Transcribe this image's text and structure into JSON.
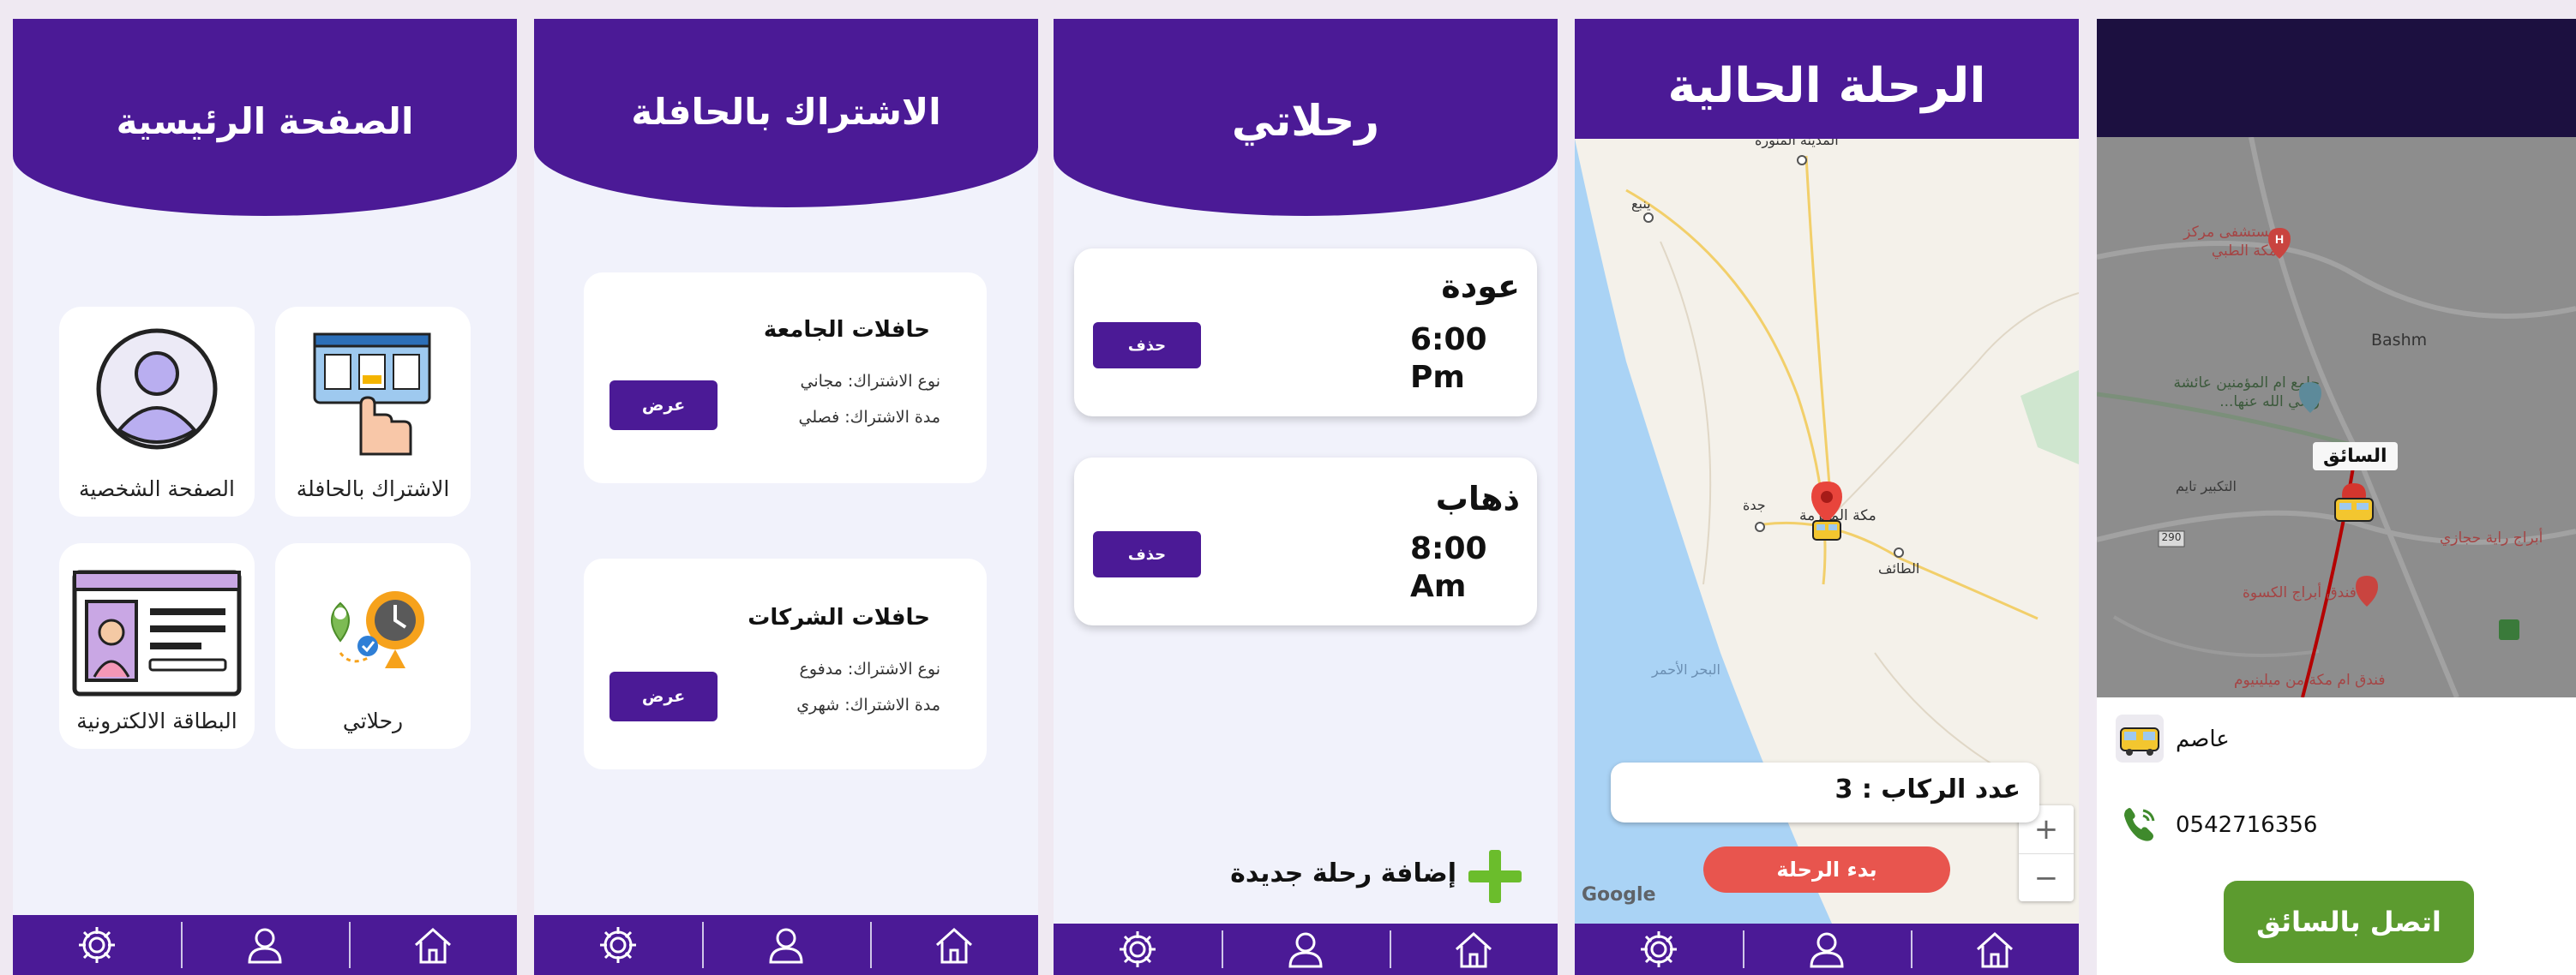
{
  "colors": {
    "primary": "#4b1a96",
    "green": "#5c9b2f",
    "red": "#e8554e",
    "background": "#f1f2fb"
  },
  "nav": {
    "icons": [
      "settings-icon",
      "user-icon",
      "home-icon"
    ]
  },
  "home": {
    "title": "الصفحة الرئيسية",
    "tiles": [
      {
        "label": "الاشتراك بالحافلة",
        "icon": "bus-subscription-icon"
      },
      {
        "label": "الصفحة الشخصية",
        "icon": "profile-icon"
      },
      {
        "label": "رحلاتي",
        "icon": "trips-icon"
      },
      {
        "label": "البطاقة الالكترونية",
        "icon": "id-card-icon"
      }
    ]
  },
  "subscription": {
    "title": "الاشتراك بالحافلة",
    "cards": [
      {
        "title": "حافلات الجامعة",
        "type": "نوع الاشتراك: مجاني",
        "duration": "مدة الاشتراك: فصلي",
        "button": "عرض"
      },
      {
        "title": "حافلات الشركات",
        "type": "نوع الاشتراك: مدفوع",
        "duration": "مدة الاشتراك: شهري",
        "button": "عرض"
      }
    ]
  },
  "trips": {
    "title": "رحلاتي",
    "items": [
      {
        "name": "عودة",
        "time": "6:00",
        "period": "Pm",
        "button": "حذف"
      },
      {
        "name": "ذهاب",
        "time": "8:00",
        "period": "Am",
        "button": "حذف"
      }
    ],
    "add_label": "إضافة رحلة جديدة"
  },
  "current_trip": {
    "title": "الرحلة الحالية",
    "map_labels": {
      "madinah": "المدينة المنورة",
      "yanbu": "ينبع",
      "jeddah": "جدة",
      "makkah": "مكة المكرمة",
      "taif": "الطائف",
      "red_sea": "البحر الأحمر",
      "google": "Google"
    },
    "passengers": "عدد الركاب : 3",
    "start_button": "بدء الرحلة",
    "zoom_in": "+",
    "zoom_out": "−"
  },
  "driver": {
    "map_labels": {
      "hospital": "مستشفى مركز مكة الطبي",
      "mosque": "جامع ام المؤمنين عائشة رضي الله عنها...",
      "bashm": "Bashm",
      "driver_tag": "السائق",
      "tower1": "أبراج راية حجازي",
      "tower2": "فندق أبراج الكسوة",
      "hotel": "فندق ام مكة من ميلينيوم",
      "takbir": "التكبير تايم",
      "road": "290"
    },
    "driver_name": "عاصم",
    "phone": "0542716356",
    "call_button": "اتصل بالسائق"
  }
}
